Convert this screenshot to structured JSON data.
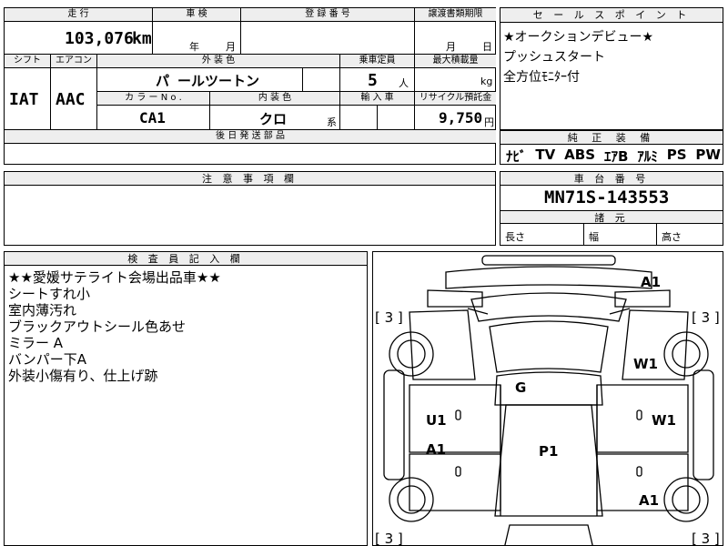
{
  "top_labels": {
    "mileage": "走 行",
    "inspection": "車 検",
    "registration": "登 録 番 号",
    "transfer_deadline": "譲渡書類期限",
    "shift": "シフト",
    "aircon": "エアコン",
    "exterior_color": "外 装 色",
    "capacity": "乗車定員",
    "max_load": "最大積載量",
    "color_no": "カ ラ ー N o .",
    "interior_color": "内 装 色",
    "import": "輸 入 車",
    "recycle": "リサイクル預託金",
    "later_parts": "後 日 発 送 部 品"
  },
  "values": {
    "mileage": "103,076",
    "mileage_unit": "km",
    "inspection_year": "年",
    "inspection_month": "月",
    "deadline_month": "月",
    "deadline_day": "日",
    "shift": "IAT",
    "aircon": "AAC",
    "exterior_color": "パ ールツートン",
    "capacity": "5",
    "capacity_unit": "人",
    "load_unit": "kg",
    "color_no": "CA1",
    "interior_color": "クロ",
    "interior_suffix": "系",
    "recycle": "9,750",
    "recycle_unit": "円"
  },
  "sales_points": {
    "title": "セ ー ル ス ポ イ ン ト",
    "lines": [
      "★オークションデビュー★",
      "プッシュスタート",
      "全方位ﾓﾆﾀｰ付"
    ]
  },
  "equipment": {
    "title": "純 正 装 備",
    "items": [
      "ﾅﾋﾞ",
      "TV",
      "ABS",
      "ｴｱB",
      "ｱﾙﾐ",
      "PS",
      "PW"
    ]
  },
  "notes": {
    "title": "注 意 事 項 欄"
  },
  "chassis": {
    "title": "車 台 番 号",
    "number": "MN71S-143553",
    "spec_title": "諸 元",
    "length": "長さ",
    "width": "幅",
    "height": "高さ"
  },
  "inspector": {
    "title": "検 査 員 記 入 欄",
    "lines": [
      "★★愛媛サテライト会場出品車★★",
      "シートすれ小",
      "室内薄汚れ",
      "ブラックアウトシール色あせ",
      "ミラー A",
      "バンパー下A",
      "外装小傷有り、仕上げ跡"
    ]
  },
  "diagram": {
    "tires": [
      "[ 3 ]",
      "[ 3 ]",
      "[ 3 ]",
      "[ 3 ]"
    ],
    "marks": [
      "A1",
      "W1",
      "G",
      "U1",
      "W1",
      "A1",
      "P1",
      "A1"
    ]
  }
}
